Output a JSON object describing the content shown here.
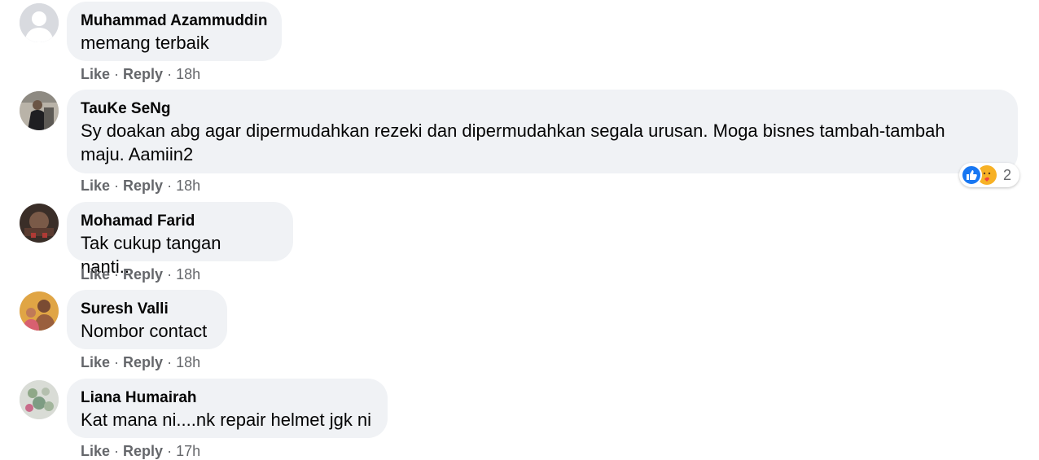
{
  "comments": [
    {
      "author": "Muhammad Azammuddin",
      "text_lines": [
        "memang terbaik"
      ],
      "actions": {
        "like": "Like",
        "reply": "Reply",
        "sep": "·",
        "time": "18h"
      }
    },
    {
      "author": "TauKe SeNg",
      "text_lines": [
        "Sy doakan abg agar dipermudahkan rezeki dan dipermudahkan segala urusan. Moga bisnes tambah-tambah",
        "maju. Aamiin2"
      ],
      "actions": {
        "like": "Like",
        "reply": "Reply",
        "sep": "·",
        "time": "18h"
      },
      "reactions": {
        "count": "2",
        "icons": [
          "like-reaction-icon",
          "care-reaction-icon"
        ]
      }
    },
    {
      "author": "Mohamad Farid",
      "text_lines": [
        "Tak cukup tangan nanti..."
      ],
      "actions": {
        "like": "Like",
        "reply": "Reply",
        "sep": "·",
        "time": "18h"
      }
    },
    {
      "author": "Suresh Valli",
      "text_lines": [
        "Nombor contact"
      ],
      "actions": {
        "like": "Like",
        "reply": "Reply",
        "sep": "·",
        "time": "18h"
      }
    },
    {
      "author": "Liana Humairah",
      "text_lines": [
        "Kat mana ni....nk repair helmet jgk ni"
      ],
      "actions": {
        "like": "Like",
        "reply": "Reply",
        "sep": "·",
        "time": "17h"
      }
    }
  ],
  "colors": {
    "bubble": "#f0f2f5",
    "action_text": "#65676b",
    "like_blue": "#1877f2"
  }
}
